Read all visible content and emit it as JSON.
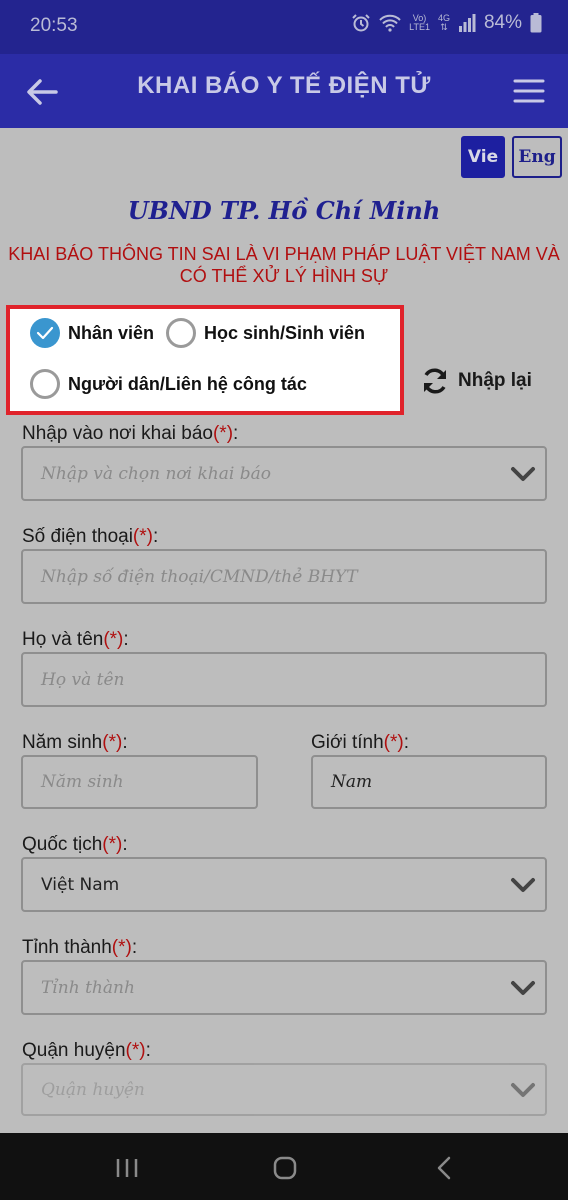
{
  "status_bar": {
    "time": "20:53",
    "net_top": "Vo)",
    "net_bottom": "LTE1",
    "net_4g": "4G",
    "battery": "84%"
  },
  "header": {
    "title": "KHAI BÁO Y TẾ ĐIỆN TỬ"
  },
  "language": {
    "vie": "Vie",
    "eng": "Eng"
  },
  "org_title": "UBND TP. Hồ Chí Minh",
  "warning": {
    "line1": "KHAI BÁO THÔNG TIN SAI LÀ VI PHẠM PHÁP LUẬT VIỆT NAM VÀ",
    "line2": "CÓ THỂ XỬ LÝ HÌNH SỰ"
  },
  "user_type": {
    "options": [
      {
        "label": "Nhân viên",
        "checked": true
      },
      {
        "label": "Học sinh/Sinh viên",
        "checked": false
      },
      {
        "label": "Người dân/Liên hệ công tác",
        "checked": false
      }
    ]
  },
  "reset_label": "Nhập lại",
  "required_mark": "(*)",
  "form": {
    "location": {
      "label": "Nhập vào nơi khai báo",
      "suffix": ":",
      "placeholder": "Nhập và chọn nơi khai báo"
    },
    "phone": {
      "label": "Số điện thoại",
      "suffix": ":",
      "placeholder": "Nhập số điện thoại/CMND/thẻ BHYT"
    },
    "name": {
      "label": "Họ và tên",
      "suffix": ":",
      "placeholder": "Họ và tên"
    },
    "birth_year": {
      "label": "Năm sinh",
      "suffix": ":",
      "placeholder": "Năm sinh"
    },
    "gender": {
      "label": "Giới tính",
      "suffix": ":",
      "value": "Nam"
    },
    "nationality": {
      "label": "Quốc tịch",
      "suffix": ":",
      "value": "Việt Nam"
    },
    "province": {
      "label": "Tỉnh thành",
      "suffix": ":",
      "placeholder": "Tỉnh thành"
    },
    "district": {
      "label": "Quận huyện",
      "suffix": ":",
      "placeholder": "Quận huyện"
    }
  },
  "colors": {
    "header_bg": "#2b2ca6",
    "status_bg": "#23248f",
    "required": "#b01010",
    "highlight_border": "#e0232b",
    "checked_radio": "#3a96cf"
  }
}
